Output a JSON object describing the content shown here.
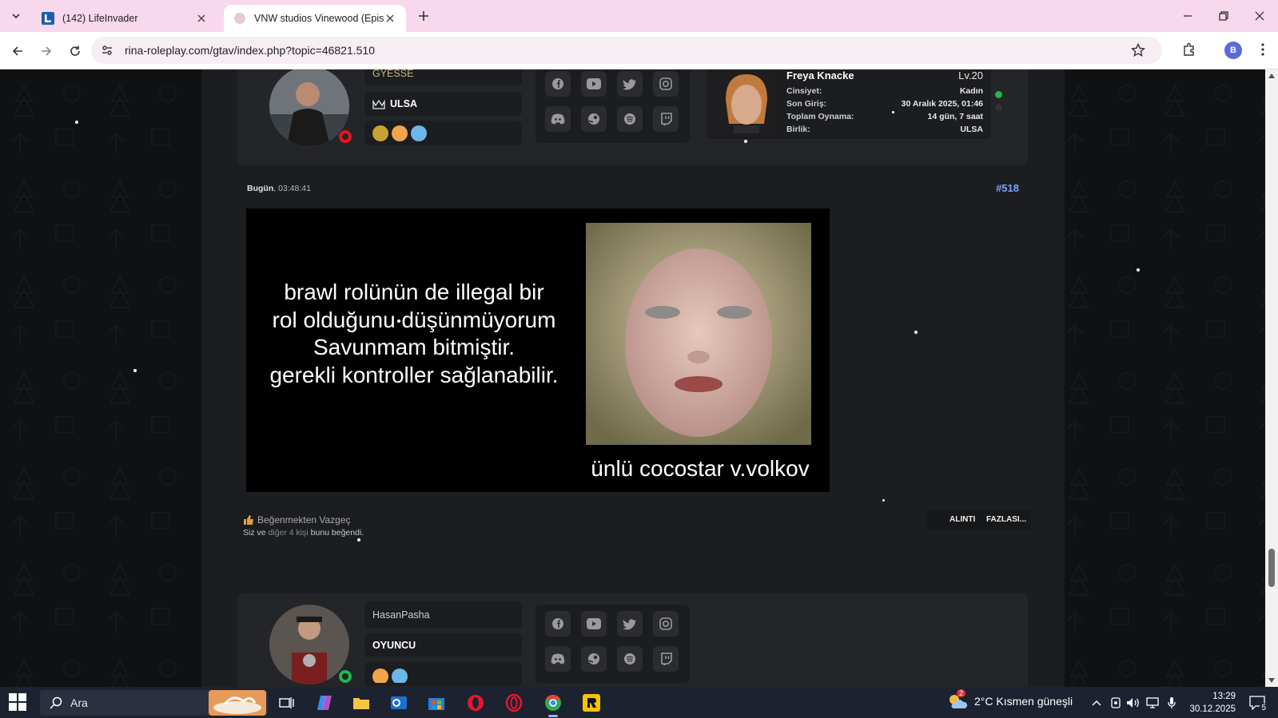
{
  "browser": {
    "tabs": [
      {
        "title": "(142) LifeInvader",
        "active": false
      },
      {
        "title": "VNW studios Vinewood (Episode",
        "active": true
      }
    ],
    "url": "rina-roleplay.com/gtav/index.php?topic=46821.510",
    "profile_initial": "B"
  },
  "prev_post": {
    "username": "GYESSE",
    "faction": "ULSA",
    "character": {
      "name": "Freya Knacke",
      "level": "Lv.20",
      "rows": [
        {
          "key": "Cinsiyet:",
          "value": "Kadın"
        },
        {
          "key": "Son Giriş:",
          "value": "30 Aralık 2025, 01:46"
        },
        {
          "key": "Toplam Oynama:",
          "value": "14 gün, 7 saat"
        },
        {
          "key": "Birlik:",
          "value": "ULSA"
        }
      ]
    }
  },
  "post": {
    "date_bold": "Bugün",
    "date_rest": ", 03:48:41",
    "number": "#518",
    "meme_lines": [
      "brawl rolünün de illegal bir",
      "rol olduğunu düşünmüyorum",
      "Savunmam bitmiştir.",
      "gerekli kontroller sağlanabilir."
    ],
    "meme_caption": "ünlü cocostar v.volkov",
    "unlike_label": "Beğenmekten Vazgeç",
    "likers": {
      "you": "Siz ve",
      "others": "diğer 4 kişi",
      "liked": "bunu beğendi."
    },
    "actions": {
      "quote": "ALINTI",
      "more": "FAZLASI..."
    }
  },
  "next_post": {
    "username": "HasanPasha",
    "rank": "OYUNCU"
  },
  "taskbar": {
    "search_placeholder": "Ara",
    "weather_badge": "2",
    "weather": "2°C  Kısmen güneşli",
    "time": "13:29",
    "date": "30.12.2025",
    "notifications": "5"
  },
  "colors": {
    "tabbar": "#f8d8ec",
    "page_bg": "#1b1d20",
    "card_bg": "#232528",
    "post_number": "#7aa6ff",
    "online": "#1fb84a",
    "offline_ring": "#e8141d"
  }
}
